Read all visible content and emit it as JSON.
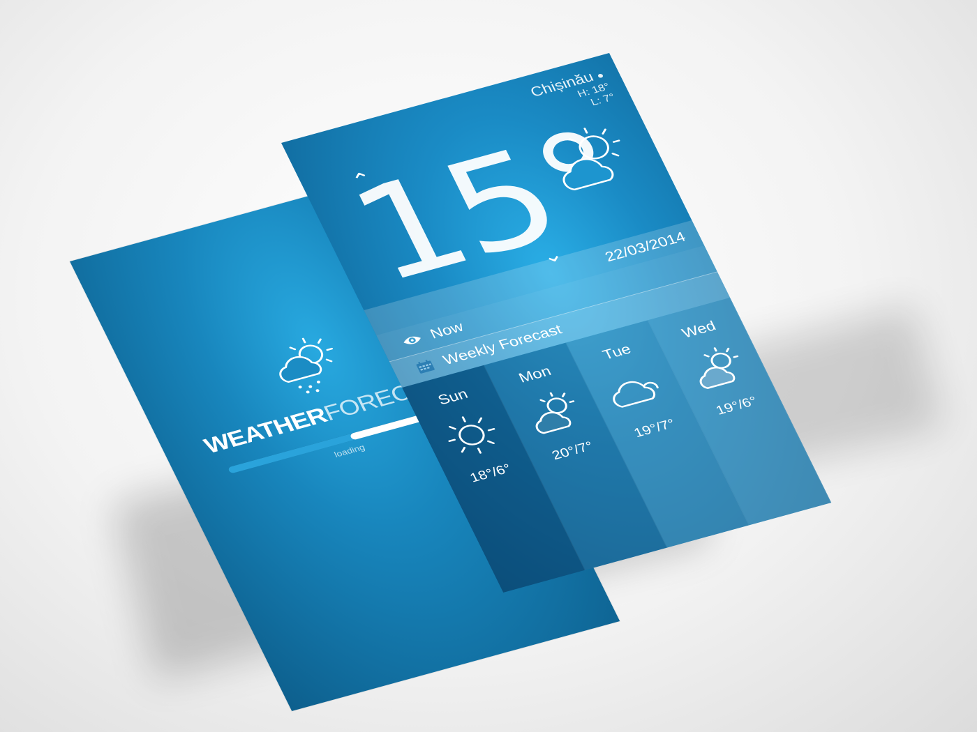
{
  "splash": {
    "brand_bold": "WEATHER",
    "brand_light": "FORECAST",
    "loading_label": "loading",
    "progress": 0.55,
    "icon": "cloud-sun-snow-icon"
  },
  "main": {
    "location": "Chișinău",
    "location_icon": "location-pin-icon",
    "high": "H: 18°",
    "low": "L: 7°",
    "temperature": "15°",
    "current_icon": "cloud-sun-icon",
    "date": "22/03/2014",
    "tabs": [
      {
        "label": "Now",
        "icon": "eye-icon"
      },
      {
        "label": "Weekly Forecast",
        "icon": "calendar-icon"
      }
    ],
    "forecast": [
      {
        "day": "Sun",
        "range": "18°/6°",
        "icon": "sun-icon"
      },
      {
        "day": "Mon",
        "range": "20°/7°",
        "icon": "cloud-sun-icon"
      },
      {
        "day": "Tue",
        "range": "19°/7°",
        "icon": "cloud-icon"
      },
      {
        "day": "Wed",
        "range": "19°/6°",
        "icon": "cloud-sun-icon"
      }
    ]
  },
  "colors": {
    "primary_blue": "#1a8bc5",
    "light_blue": "#2aaee6",
    "dark_blue": "#0d5f8d",
    "text": "#ffffff"
  }
}
